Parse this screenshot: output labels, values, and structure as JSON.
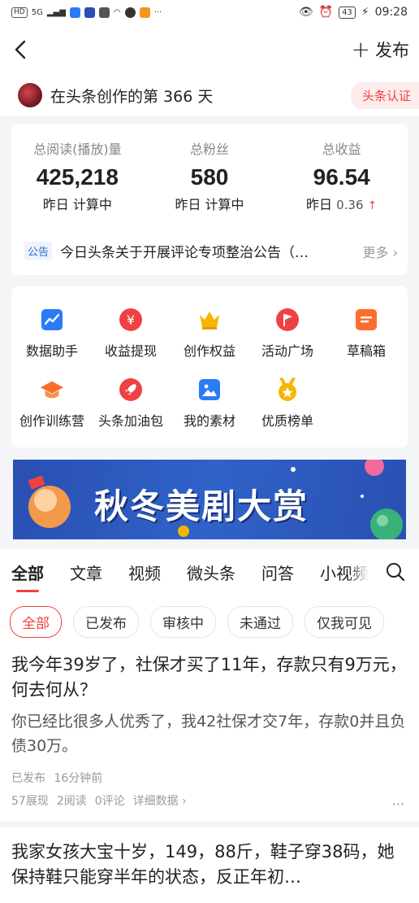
{
  "status_bar": {
    "left_badges": [
      "HD",
      "5G"
    ],
    "time": "09:28",
    "battery": "43"
  },
  "header": {
    "publish_label": "发布"
  },
  "creator": {
    "days_text": "在头条创作的第 366 天",
    "certify_label": "头条认证"
  },
  "stats": [
    {
      "label": "总阅读(播放)量",
      "value": "425,218",
      "sub_prefix": "昨日 计算中",
      "sub_value": ""
    },
    {
      "label": "总粉丝",
      "value": "580",
      "sub_prefix": "昨日 计算中",
      "sub_value": ""
    },
    {
      "label": "总收益",
      "value": "96.54",
      "sub_prefix": "昨日",
      "sub_value": "0.36"
    }
  ],
  "notice": {
    "tag": "公告",
    "text": "今日头条关于开展评论专项整治公告（…",
    "more_label": "更多"
  },
  "tools": [
    {
      "label": "数据助手",
      "icon": "chart-icon",
      "color": "#2a7bf6"
    },
    {
      "label": "收益提现",
      "icon": "yen-icon",
      "color": "#f04142"
    },
    {
      "label": "创作权益",
      "icon": "crown-icon",
      "color": "#f7b500"
    },
    {
      "label": "活动广场",
      "icon": "flag-icon",
      "color": "#f04142"
    },
    {
      "label": "草稿箱",
      "icon": "draft-icon",
      "color": "#fa6d2d"
    },
    {
      "label": "创作训练营",
      "icon": "graduation-cap-icon",
      "color": "#fa6d2d"
    },
    {
      "label": "头条加油包",
      "icon": "rocket-icon",
      "color": "#f04142"
    },
    {
      "label": "我的素材",
      "icon": "image-icon",
      "color": "#2a7bf6"
    },
    {
      "label": "优质榜单",
      "icon": "medal-icon",
      "color": "#f7b500"
    }
  ],
  "banner": {
    "text": "秋冬美剧大赏"
  },
  "tabs": [
    "全部",
    "文章",
    "视频",
    "微头条",
    "问答",
    "小视频"
  ],
  "filters": [
    "全部",
    "已发布",
    "审核中",
    "未通过",
    "仅我可见"
  ],
  "articles": [
    {
      "title": "我今年39岁了，社保才买了11年，存款只有9万元，何去何从？",
      "summary": "你已经比很多人优秀了，我42社保才交7年，存款0并且负债30万。",
      "status": "已发布",
      "time": "16分钟前",
      "views": "57展现",
      "reads": "2阅读",
      "comments": "0评论",
      "detail_label": "详细数据"
    },
    {
      "title": "我家女孩大宝十岁，149，88斤，鞋子穿38码，她保持鞋只能穿半年的状态，反正年初…"
    }
  ],
  "colors": {
    "accent": "#f04142",
    "link_blue": "#2a6ccf"
  }
}
